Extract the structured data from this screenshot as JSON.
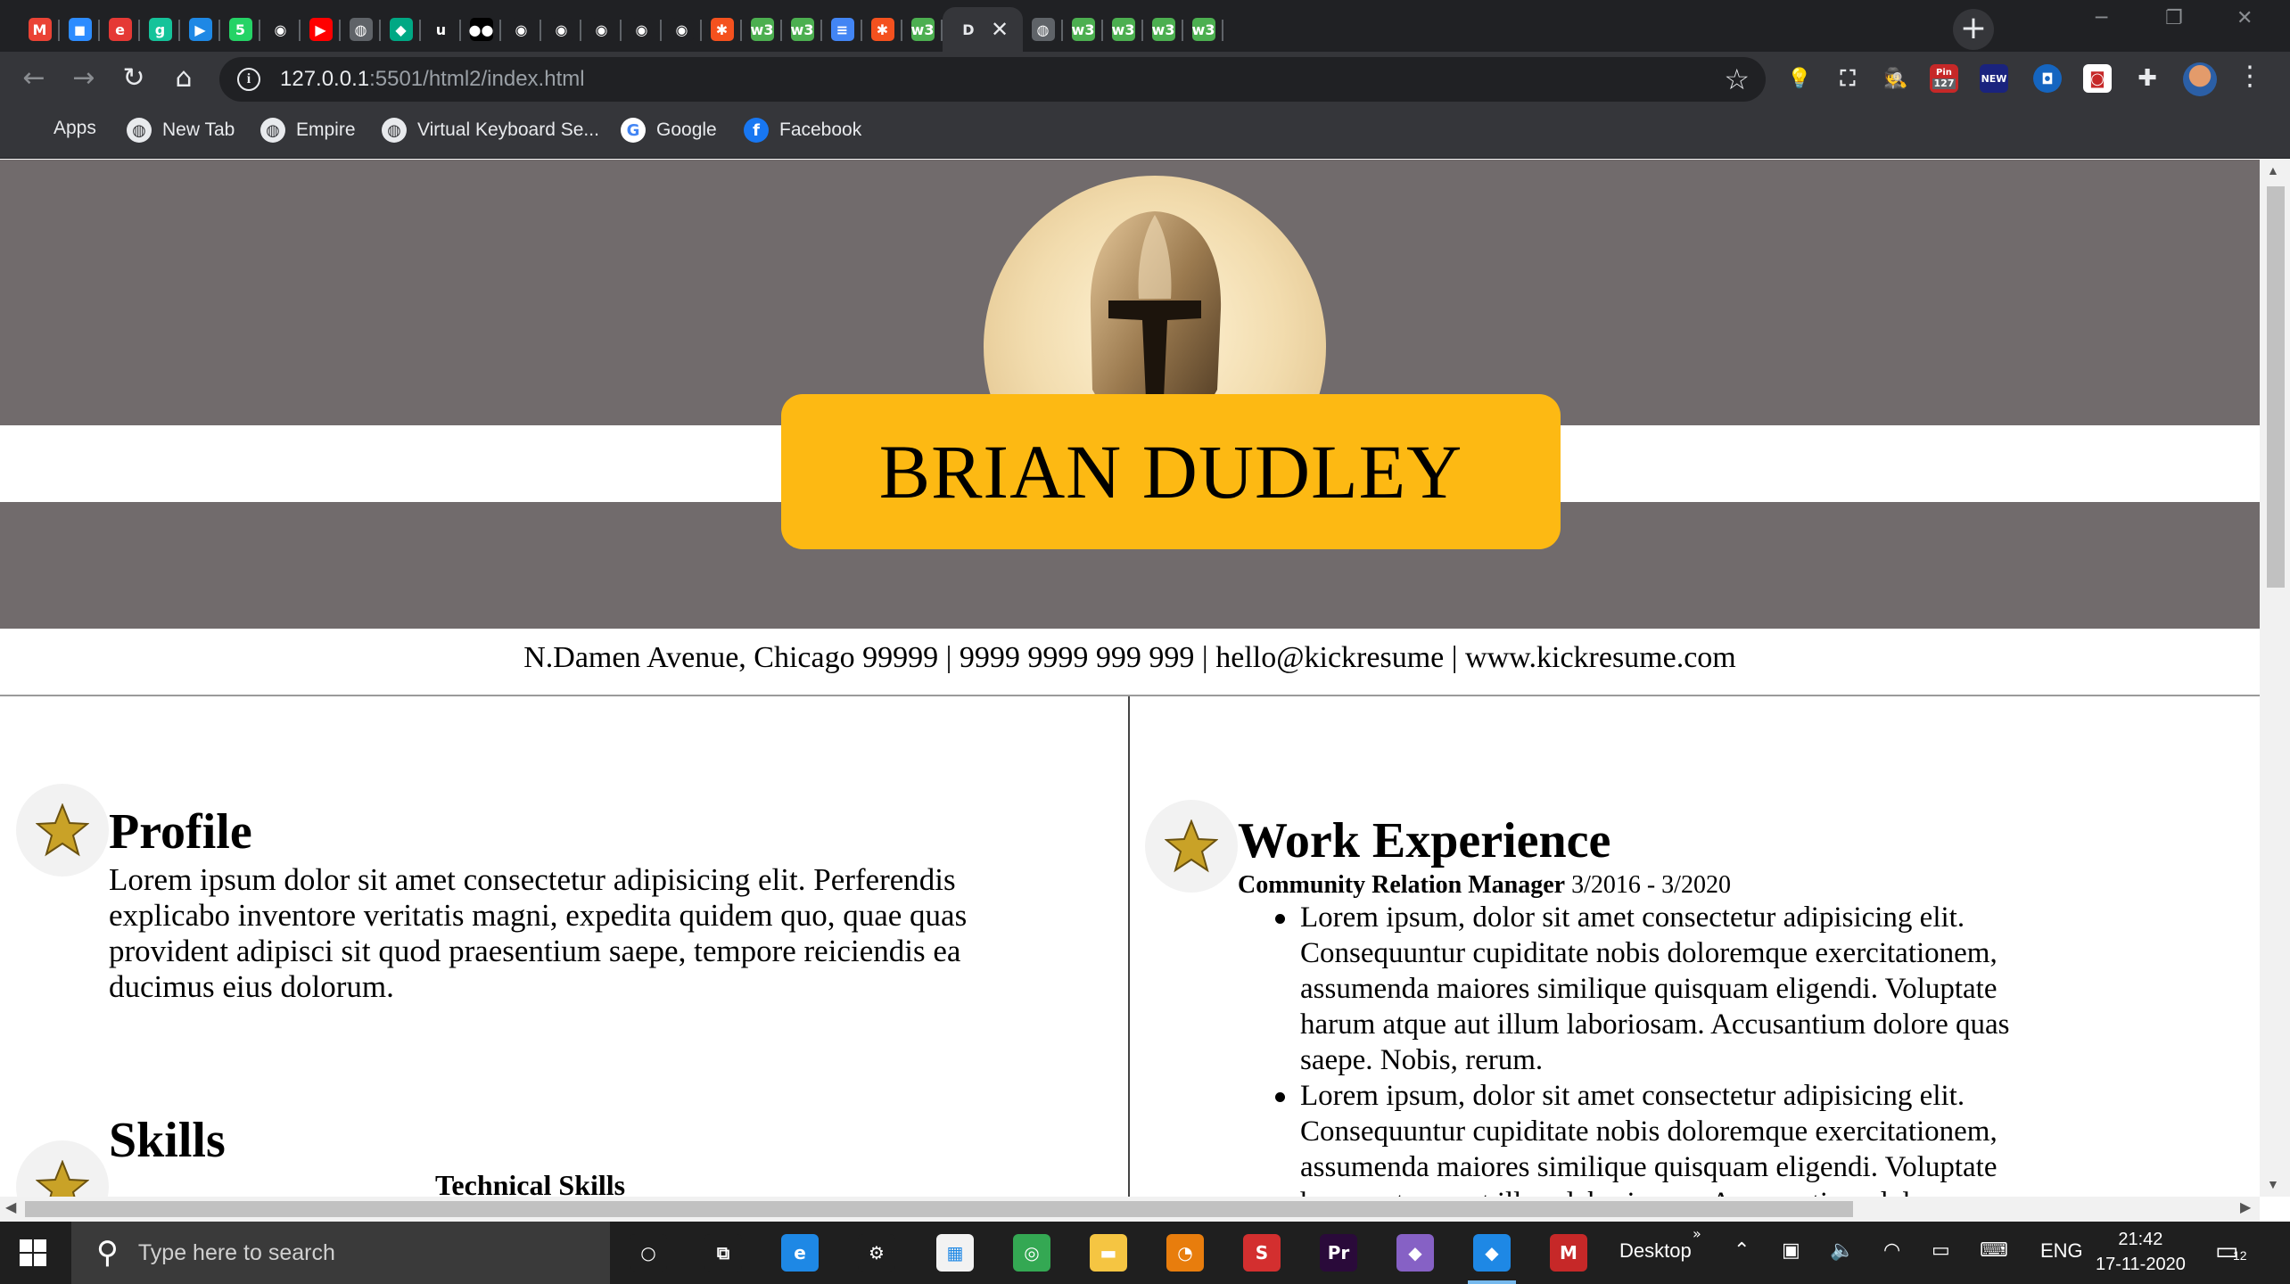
{
  "browser": {
    "tabs": [
      {
        "letter": "M",
        "color": "#ea4335"
      },
      {
        "letter": "◼",
        "color": "#2d8cff"
      },
      {
        "letter": "e",
        "color": "#e53935"
      },
      {
        "letter": "g",
        "color": "#15c39a"
      },
      {
        "letter": "▶",
        "color": "#1e88e5"
      },
      {
        "letter": "5",
        "color": "#25d366"
      },
      {
        "letter": "◉",
        "color": "#202124"
      },
      {
        "letter": "▶",
        "color": "#ff0000"
      },
      {
        "letter": "◍",
        "color": "#5f6368"
      },
      {
        "letter": "◆",
        "color": "#00a884"
      },
      {
        "letter": "u",
        "color": "#202124"
      },
      {
        "letter": "●●",
        "color": "#000000"
      },
      {
        "letter": "◉",
        "color": "#202124"
      },
      {
        "letter": "◉",
        "color": "#202124"
      },
      {
        "letter": "◉",
        "color": "#202124"
      },
      {
        "letter": "◉",
        "color": "#202124"
      },
      {
        "letter": "◉",
        "color": "#202124"
      },
      {
        "letter": "✱",
        "color": "#f4511e"
      },
      {
        "letter": "w3",
        "color": "#4caf50"
      },
      {
        "letter": "w3",
        "color": "#4caf50"
      },
      {
        "letter": "≡",
        "color": "#4285f4"
      },
      {
        "letter": "✱",
        "color": "#f4511e"
      },
      {
        "letter": "w3",
        "color": "#4caf50"
      },
      {
        "letter": "D",
        "color": "#35363a",
        "active": true
      },
      {
        "letter": "◍",
        "color": "#5f6368"
      },
      {
        "letter": "w3",
        "color": "#4caf50"
      },
      {
        "letter": "w3",
        "color": "#4caf50"
      },
      {
        "letter": "w3",
        "color": "#4caf50"
      },
      {
        "letter": "w3",
        "color": "#4caf50"
      }
    ],
    "url_host": "127.0.0.1",
    "url_rest": ":5501/html2/index.html",
    "bookmarks": {
      "apps": "Apps",
      "new_tab": "New Tab",
      "empire": "Empire",
      "virtual_keyboard": "Virtual Keyboard Se...",
      "google": "Google",
      "facebook": "Facebook"
    },
    "extension_badges": {
      "pin_count": "127",
      "new": "NEW"
    }
  },
  "resume": {
    "name": "BRIAN DUDLEY",
    "contact": "N.Damen Avenue, Chicago 99999 | 9999 9999 999 999 | hello@kickresume | www.kickresume.com",
    "profile": {
      "title": "Profile",
      "text": "Lorem ipsum dolor sit amet consectetur adipisicing elit. Perferendis explicabo inventore veritatis magni, expedita quidem quo, quae quas provident adipisci sit quod praesentium saepe, tempore reiciendis ea ducimus eius dolorum."
    },
    "skills": {
      "title": "Skills",
      "subtitle": "Technical Skills"
    },
    "work": {
      "title": "Work Experience",
      "role": "Community Relation Manager",
      "dates": "3/2016 - 3/2020",
      "bullets": [
        "Lorem ipsum, dolor sit amet consectetur adipisicing elit. Consequuntur cupiditate nobis doloremque exercitationem, assumenda maiores similique quisquam eligendi. Voluptate harum atque aut illum laboriosam. Accusantium dolore quas saepe. Nobis, rerum.",
        "Lorem ipsum, dolor sit amet consectetur adipisicing elit. Consequuntur cupiditate nobis doloremque exercitationem, assumenda maiores similique quisquam eligendi. Voluptate harum atque aut illum laboriosam. Accusantium dolore quas saepe. Nobis, rerum."
      ]
    },
    "colors": {
      "header_gray": "#716b6c",
      "name_box": "#fdb913"
    }
  },
  "taskbar": {
    "search_placeholder": "Type here to search",
    "desktop_label": "Desktop",
    "language": "ENG",
    "time": "21:42",
    "date": "17-11-2020",
    "notification_count": "12",
    "apps": [
      {
        "name": "cortana",
        "glyph": "○",
        "color": "#1f1f1f"
      },
      {
        "name": "task-view",
        "glyph": "⧉",
        "color": "#1f1f1f"
      },
      {
        "name": "edge",
        "glyph": "e",
        "color": "#1e88e5"
      },
      {
        "name": "settings",
        "glyph": "⚙",
        "color": "#1f1f1f"
      },
      {
        "name": "store",
        "glyph": "▦",
        "color": "#f2f2f2"
      },
      {
        "name": "chrome",
        "glyph": "◎",
        "color": "#34a853"
      },
      {
        "name": "explorer",
        "glyph": "▬",
        "color": "#f5c542"
      },
      {
        "name": "blender",
        "glyph": "◔",
        "color": "#e87d0d"
      },
      {
        "name": "sketchup",
        "glyph": "S",
        "color": "#d32f2f"
      },
      {
        "name": "premiere",
        "glyph": "Pr",
        "color": "#2a0a3a"
      },
      {
        "name": "visual-studio",
        "glyph": "◆",
        "color": "#8661c5"
      },
      {
        "name": "vscode",
        "glyph": "◆",
        "color": "#1e88e5"
      },
      {
        "name": "mcafee",
        "glyph": "M",
        "color": "#c62828"
      }
    ]
  }
}
